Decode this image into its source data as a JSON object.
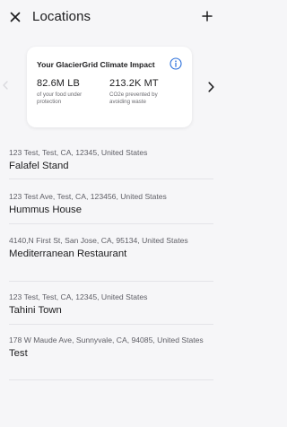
{
  "header": {
    "title": "Locations",
    "close_icon": "close-icon",
    "add_icon": "plus-icon"
  },
  "impact_card": {
    "title": "Your GlacierGrid Climate Impact",
    "info_icon": "info-icon",
    "stats": [
      {
        "value": "82.6M LB",
        "label": "of your food under protection"
      },
      {
        "value": "213.2K MT",
        "label": "CO2e prevented by avoiding waste"
      }
    ],
    "accent_color": "#2a6fdb"
  },
  "carousel": {
    "prev_icon": "chevron-left-icon",
    "next_icon": "chevron-right-icon"
  },
  "locations": [
    {
      "address": "123 Test, Test, CA, 12345, United States",
      "name": "Falafel Stand"
    },
    {
      "address": "123 Test Ave, Test, CA, 123456, United States",
      "name": "Hummus House"
    },
    {
      "address": "4140,N First St, San Jose, CA, 95134, United States",
      "name": "Mediterranean Restaurant"
    },
    {
      "address": "123 Test, Test, CA, 12345, United States",
      "name": "Tahini Town"
    },
    {
      "address": "178 W Maude Ave, Sunnyvale, CA, 94085, United States",
      "name": "Test"
    }
  ]
}
